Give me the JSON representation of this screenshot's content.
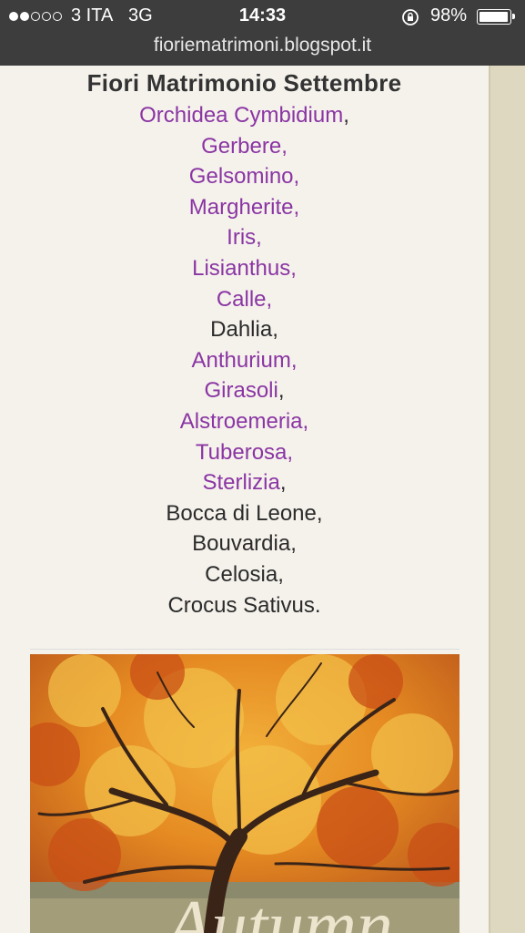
{
  "status_bar": {
    "carrier": "3 ITA",
    "network": "3G",
    "time": "14:33",
    "battery": "98%",
    "battery_level": 0.98,
    "url": "fioriematrimoni.blogspot.it"
  },
  "post": {
    "title": "Fiori Matrimonio Settembre",
    "flowers": [
      {
        "name": "Orchidea Cymbidium",
        "linked": true,
        "suffix_inside_link": false
      },
      {
        "name": "Gerbere",
        "linked": true,
        "suffix_inside_link": true
      },
      {
        "name": "Gelsomino",
        "linked": true,
        "suffix_inside_link": true
      },
      {
        "name": "Margherite",
        "linked": true,
        "suffix_inside_link": true
      },
      {
        "name": "Iris",
        "linked": true,
        "suffix_inside_link": true
      },
      {
        "name": "Lisianthus",
        "linked": true,
        "suffix_inside_link": true
      },
      {
        "name": "Calle",
        "linked": true,
        "suffix_inside_link": true
      },
      {
        "name": "Dahlia",
        "linked": false,
        "suffix_inside_link": false
      },
      {
        "name": "Anthurium",
        "linked": true,
        "suffix_inside_link": true
      },
      {
        "name": "Girasoli",
        "linked": true,
        "suffix_inside_link": false
      },
      {
        "name": "Alstroemeria",
        "linked": true,
        "suffix_inside_link": true
      },
      {
        "name": "Tuberosa",
        "linked": true,
        "suffix_inside_link": true
      },
      {
        "name": "Sterlizia",
        "linked": true,
        "suffix_inside_link": false
      },
      {
        "name": "Bocca di Leone",
        "linked": false,
        "suffix_inside_link": false
      },
      {
        "name": "Bouvardia",
        "linked": false,
        "suffix_inside_link": false
      },
      {
        "name": "Celosia",
        "linked": false,
        "suffix_inside_link": false
      },
      {
        "name": "Crocus Sativus",
        "linked": false,
        "suffix_inside_link": false
      }
    ],
    "separators": [
      ",",
      ",",
      ",",
      ",",
      ",",
      ",",
      ",",
      ",",
      ",",
      ",",
      ",",
      ",",
      ",",
      ",",
      ",",
      ",",
      "."
    ],
    "image_caption_fragment": "Autumn"
  },
  "colors": {
    "link": "#8a35a3",
    "text": "#2b2b2b",
    "page_background": "#f5f2ec",
    "sidebar": "#ddd8bf",
    "status_bar": "#3d3d3d"
  }
}
